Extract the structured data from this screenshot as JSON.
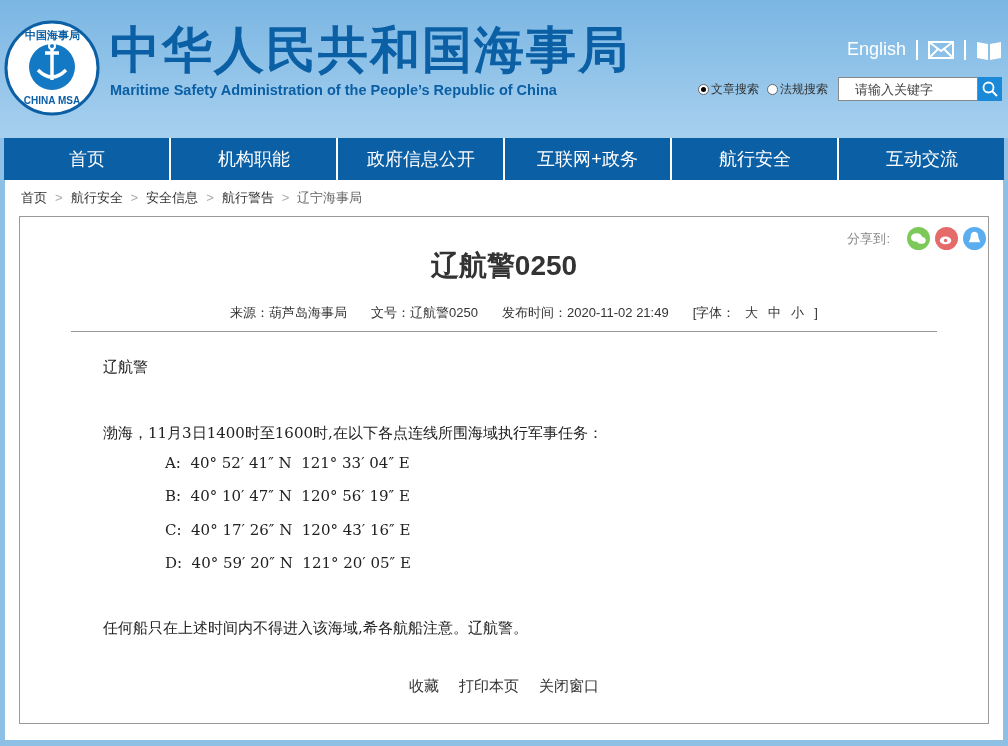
{
  "header": {
    "logo": {
      "top_text": "中国海事局",
      "bottom_text": "CHINA MSA"
    },
    "title": "中华人民共和国海事局",
    "subtitle": "Maritime Safety Administration of the People’s Republic of China",
    "language_link": "English",
    "search_types": [
      {
        "label": "文章搜索",
        "selected": true
      },
      {
        "label": "法规搜索",
        "selected": false
      }
    ],
    "search": {
      "placeholder": "请输入关键字"
    }
  },
  "nav": [
    "首页",
    "机构职能",
    "政府信息公开",
    "互联网+政务",
    "航行安全",
    "互动交流"
  ],
  "breadcrumb": [
    {
      "label": "首页"
    },
    {
      "separator": ">",
      "label": "航行安全"
    },
    {
      "separator": ">",
      "label": "安全信息"
    },
    {
      "separator": ">",
      "label": "航行警告"
    },
    {
      "separator": ">",
      "label": "辽宁海事局"
    }
  ],
  "article": {
    "share_label": "分享到:",
    "title": "辽航警0250",
    "meta": {
      "source": "来源：葫芦岛海事局",
      "doc_no": "文号：辽航警0250",
      "published": "发布时间：2020-11-02 21:49",
      "font_label": "[字体：",
      "font_sizes": [
        "大",
        "中",
        "小"
      ],
      "font_close": "]"
    },
    "heading": "辽航警",
    "intro": "渤海，11月3日1400时至1600时,在以下各点连线所围海域执行军事任务：",
    "points": [
      "A:  40° 52′ 41″ N  121° 33′ 04″ E",
      "B:  40° 10′ 47″ N  120° 56′ 19″ E",
      "C:  40° 17′ 26″ N  120° 43′ 16″ E",
      "D:  40° 59′ 20″ N  121° 20′ 05″ E"
    ],
    "closing": "任何船只在上述时间内不得进入该海域,希各航船注意。辽航警。",
    "actions": [
      "收藏",
      "打印本页",
      "关闭窗口"
    ]
  }
}
